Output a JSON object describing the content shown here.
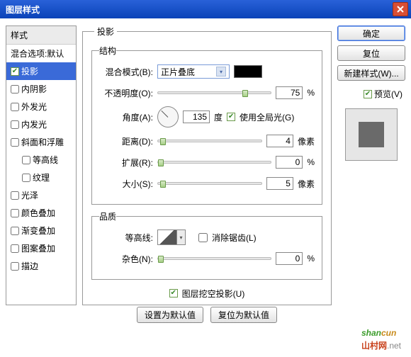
{
  "window": {
    "title": "图层样式"
  },
  "styleList": {
    "header": "样式",
    "blendOpts": "混合选项:默认",
    "items": [
      {
        "label": "投影",
        "checked": true,
        "selected": true
      },
      {
        "label": "内阴影",
        "checked": false
      },
      {
        "label": "外发光",
        "checked": false
      },
      {
        "label": "内发光",
        "checked": false
      },
      {
        "label": "斜面和浮雕",
        "checked": false
      },
      {
        "label": "等高线",
        "checked": false,
        "indent": true
      },
      {
        "label": "纹理",
        "checked": false,
        "indent": true
      },
      {
        "label": "光泽",
        "checked": false
      },
      {
        "label": "颜色叠加",
        "checked": false
      },
      {
        "label": "渐变叠加",
        "checked": false
      },
      {
        "label": "图案叠加",
        "checked": false
      },
      {
        "label": "描边",
        "checked": false
      }
    ]
  },
  "panel": {
    "title": "投影",
    "structure": {
      "title": "结构",
      "blendMode": {
        "label": "混合模式(B):",
        "value": "正片叠底"
      },
      "opacity": {
        "label": "不透明度(O):",
        "value": "75",
        "unit": "%",
        "pos": 75
      },
      "angle": {
        "label": "角度(A):",
        "value": "135",
        "unit": "度"
      },
      "globalLight": {
        "label": "使用全局光(G)",
        "checked": true
      },
      "distance": {
        "label": "距离(D):",
        "value": "4",
        "unit": "像素",
        "pos": 2
      },
      "spread": {
        "label": "扩展(R):",
        "value": "0",
        "unit": "%",
        "pos": 0
      },
      "size": {
        "label": "大小(S):",
        "value": "5",
        "unit": "像素",
        "pos": 2
      }
    },
    "quality": {
      "title": "品质",
      "contour": {
        "label": "等高线:"
      },
      "antialias": {
        "label": "消除锯齿(L)",
        "checked": false
      },
      "noise": {
        "label": "杂色(N):",
        "value": "0",
        "unit": "%",
        "pos": 0
      }
    },
    "knockout": {
      "label": "图层挖空投影(U)",
      "checked": true
    },
    "setDefault": "设置为默认值",
    "resetDefault": "复位为默认值"
  },
  "right": {
    "ok": "确定",
    "reset": "复位",
    "newStyle": "新建样式(W)...",
    "preview": {
      "label": "预览(V)",
      "checked": true
    }
  },
  "watermark": {
    "a": "shan",
    "b": "cun",
    "sub1": "山村网",
    "sub2": ".net"
  }
}
